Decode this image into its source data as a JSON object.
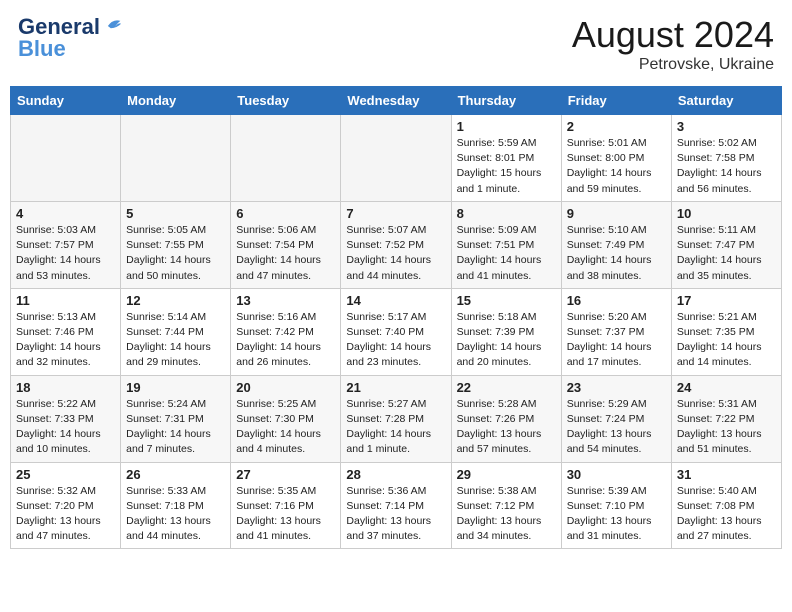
{
  "header": {
    "logo_general": "General",
    "logo_blue": "Blue",
    "month_year": "August 2024",
    "location": "Petrovske, Ukraine"
  },
  "days_of_week": [
    "Sunday",
    "Monday",
    "Tuesday",
    "Wednesday",
    "Thursday",
    "Friday",
    "Saturday"
  ],
  "weeks": [
    [
      {
        "num": "",
        "empty": true
      },
      {
        "num": "",
        "empty": true
      },
      {
        "num": "",
        "empty": true
      },
      {
        "num": "",
        "empty": true
      },
      {
        "num": "1",
        "sunrise": "5:59 AM",
        "sunset": "8:01 PM",
        "daylight": "Daylight: 15 hours and 1 minute."
      },
      {
        "num": "2",
        "sunrise": "5:01 AM",
        "sunset": "8:00 PM",
        "daylight": "Daylight: 14 hours and 59 minutes."
      },
      {
        "num": "3",
        "sunrise": "5:02 AM",
        "sunset": "7:58 PM",
        "daylight": "Daylight: 14 hours and 56 minutes."
      }
    ],
    [
      {
        "num": "4",
        "sunrise": "5:03 AM",
        "sunset": "7:57 PM",
        "daylight": "Daylight: 14 hours and 53 minutes."
      },
      {
        "num": "5",
        "sunrise": "5:05 AM",
        "sunset": "7:55 PM",
        "daylight": "Daylight: 14 hours and 50 minutes."
      },
      {
        "num": "6",
        "sunrise": "5:06 AM",
        "sunset": "7:54 PM",
        "daylight": "Daylight: 14 hours and 47 minutes."
      },
      {
        "num": "7",
        "sunrise": "5:07 AM",
        "sunset": "7:52 PM",
        "daylight": "Daylight: 14 hours and 44 minutes."
      },
      {
        "num": "8",
        "sunrise": "5:09 AM",
        "sunset": "7:51 PM",
        "daylight": "Daylight: 14 hours and 41 minutes."
      },
      {
        "num": "9",
        "sunrise": "5:10 AM",
        "sunset": "7:49 PM",
        "daylight": "Daylight: 14 hours and 38 minutes."
      },
      {
        "num": "10",
        "sunrise": "5:11 AM",
        "sunset": "7:47 PM",
        "daylight": "Daylight: 14 hours and 35 minutes."
      }
    ],
    [
      {
        "num": "11",
        "sunrise": "5:13 AM",
        "sunset": "7:46 PM",
        "daylight": "Daylight: 14 hours and 32 minutes."
      },
      {
        "num": "12",
        "sunrise": "5:14 AM",
        "sunset": "7:44 PM",
        "daylight": "Daylight: 14 hours and 29 minutes."
      },
      {
        "num": "13",
        "sunrise": "5:16 AM",
        "sunset": "7:42 PM",
        "daylight": "Daylight: 14 hours and 26 minutes."
      },
      {
        "num": "14",
        "sunrise": "5:17 AM",
        "sunset": "7:40 PM",
        "daylight": "Daylight: 14 hours and 23 minutes."
      },
      {
        "num": "15",
        "sunrise": "5:18 AM",
        "sunset": "7:39 PM",
        "daylight": "Daylight: 14 hours and 20 minutes."
      },
      {
        "num": "16",
        "sunrise": "5:20 AM",
        "sunset": "7:37 PM",
        "daylight": "Daylight: 14 hours and 17 minutes."
      },
      {
        "num": "17",
        "sunrise": "5:21 AM",
        "sunset": "7:35 PM",
        "daylight": "Daylight: 14 hours and 14 minutes."
      }
    ],
    [
      {
        "num": "18",
        "sunrise": "5:22 AM",
        "sunset": "7:33 PM",
        "daylight": "Daylight: 14 hours and 10 minutes."
      },
      {
        "num": "19",
        "sunrise": "5:24 AM",
        "sunset": "7:31 PM",
        "daylight": "Daylight: 14 hours and 7 minutes."
      },
      {
        "num": "20",
        "sunrise": "5:25 AM",
        "sunset": "7:30 PM",
        "daylight": "Daylight: 14 hours and 4 minutes."
      },
      {
        "num": "21",
        "sunrise": "5:27 AM",
        "sunset": "7:28 PM",
        "daylight": "Daylight: 14 hours and 1 minute."
      },
      {
        "num": "22",
        "sunrise": "5:28 AM",
        "sunset": "7:26 PM",
        "daylight": "Daylight: 13 hours and 57 minutes."
      },
      {
        "num": "23",
        "sunrise": "5:29 AM",
        "sunset": "7:24 PM",
        "daylight": "Daylight: 13 hours and 54 minutes."
      },
      {
        "num": "24",
        "sunrise": "5:31 AM",
        "sunset": "7:22 PM",
        "daylight": "Daylight: 13 hours and 51 minutes."
      }
    ],
    [
      {
        "num": "25",
        "sunrise": "5:32 AM",
        "sunset": "7:20 PM",
        "daylight": "Daylight: 13 hours and 47 minutes."
      },
      {
        "num": "26",
        "sunrise": "5:33 AM",
        "sunset": "7:18 PM",
        "daylight": "Daylight: 13 hours and 44 minutes."
      },
      {
        "num": "27",
        "sunrise": "5:35 AM",
        "sunset": "7:16 PM",
        "daylight": "Daylight: 13 hours and 41 minutes."
      },
      {
        "num": "28",
        "sunrise": "5:36 AM",
        "sunset": "7:14 PM",
        "daylight": "Daylight: 13 hours and 37 minutes."
      },
      {
        "num": "29",
        "sunrise": "5:38 AM",
        "sunset": "7:12 PM",
        "daylight": "Daylight: 13 hours and 34 minutes."
      },
      {
        "num": "30",
        "sunrise": "5:39 AM",
        "sunset": "7:10 PM",
        "daylight": "Daylight: 13 hours and 31 minutes."
      },
      {
        "num": "31",
        "sunrise": "5:40 AM",
        "sunset": "7:08 PM",
        "daylight": "Daylight: 13 hours and 27 minutes."
      }
    ]
  ]
}
